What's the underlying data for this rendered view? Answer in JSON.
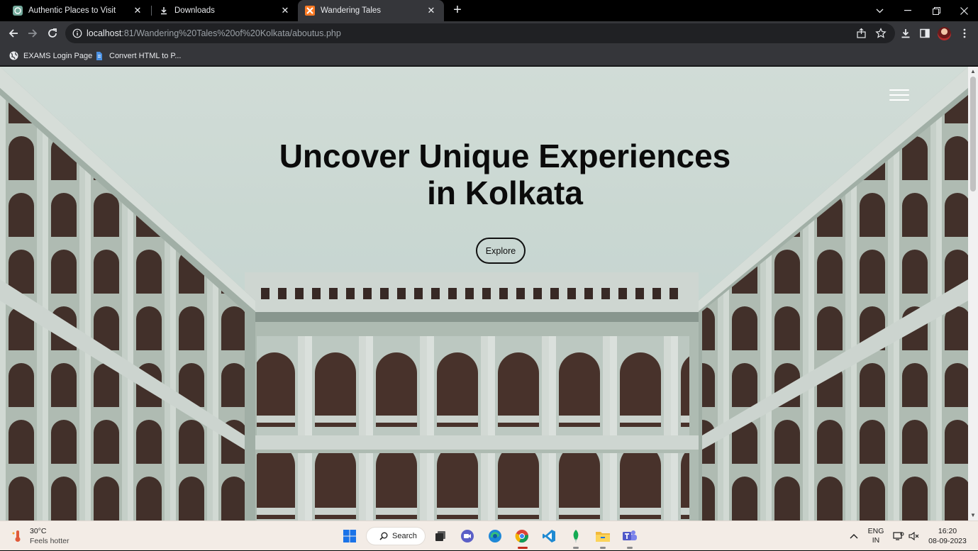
{
  "browser": {
    "tabs": [
      {
        "title": "Authentic Places to Visit",
        "favicon": "openai-icon",
        "active": false
      },
      {
        "title": "Downloads",
        "favicon": "download-icon",
        "active": false
      },
      {
        "title": "Wandering Tales",
        "favicon": "xampp-icon",
        "active": true
      }
    ],
    "new_tab_label": "+",
    "address": {
      "host": "localhost",
      "rest": ":81/Wandering%20Tales%20of%20Kolkata/aboutus.php"
    },
    "bookmarks": [
      {
        "label": "EXAMS Login Page",
        "icon": "globe-icon"
      },
      {
        "label": "Convert HTML to P...",
        "icon": "doc-icon"
      }
    ]
  },
  "page": {
    "hero_title_line1": "Uncover Unique Experiences",
    "hero_title_line2": "in Kolkata",
    "explore_label": "Explore",
    "menu_icon": "hamburger-icon"
  },
  "taskbar": {
    "weather_temp": "30°C",
    "weather_desc": "Feels hotter",
    "search_label": "Search",
    "language_line1": "ENG",
    "language_line2": "IN",
    "time": "16:20",
    "date": "08-09-2023",
    "apps": [
      "start-icon",
      "search",
      "task-view-icon",
      "meet-icon",
      "edge-icon",
      "chrome-icon",
      "vscode-icon",
      "mongodb-icon",
      "file-explorer-icon",
      "teams-icon"
    ]
  },
  "colors": {
    "tab_strip": "#000000",
    "toolbar": "#35363a",
    "omnibox": "#202124",
    "taskbar": "#f3ece6",
    "hero_text": "#0b0b0b"
  }
}
